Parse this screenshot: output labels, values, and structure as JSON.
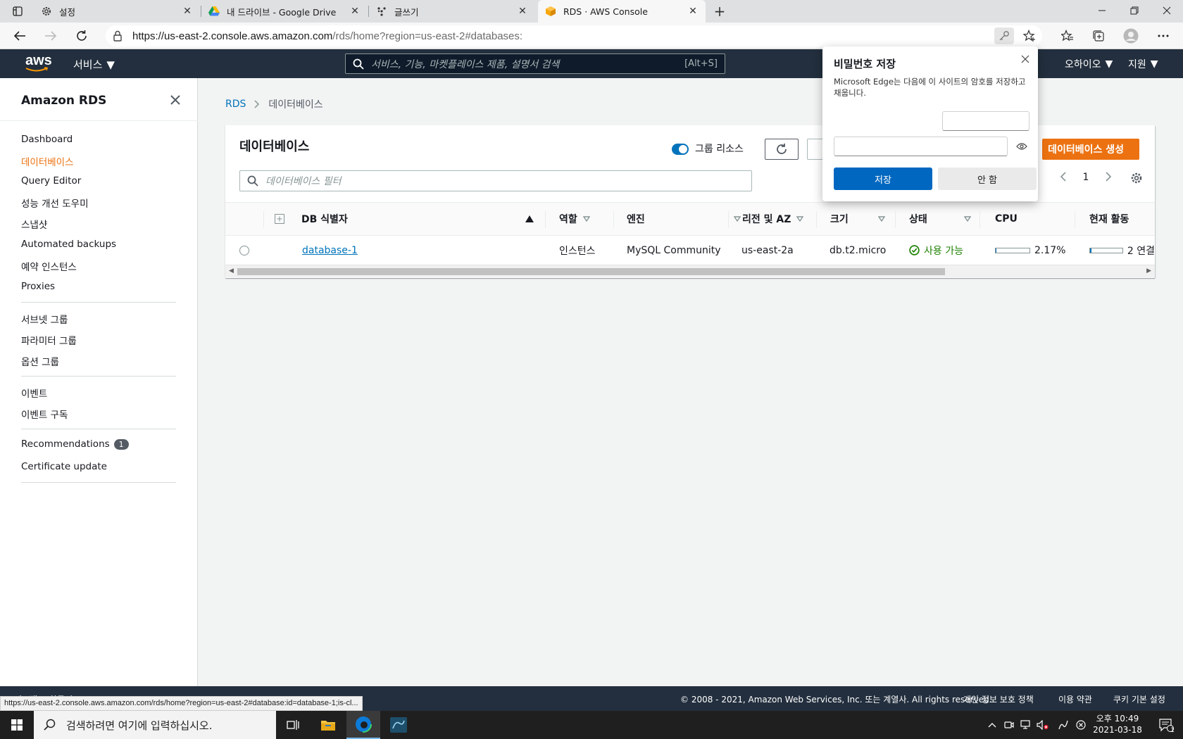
{
  "browser": {
    "tabs": [
      {
        "title": "설정",
        "icon": "gear-icon"
      },
      {
        "title": "내 드라이브 - Google Drive",
        "icon": "google-drive-icon"
      },
      {
        "title": "글쓰기",
        "icon": "app-icon"
      },
      {
        "title": "RDS · AWS Console",
        "icon": "aws-cube-icon",
        "active": true
      }
    ],
    "url_main": "https://us-east-2.console.aws.amazon.com",
    "url_rest": "/rds/home?region=us-east-2#databases:"
  },
  "awsnav": {
    "logo_text": "aws",
    "services_label": "서비스",
    "search_placeholder": "서비스, 기능, 마켓플레이스 제품, 설명서 검색",
    "search_shortcut": "[Alt+S]",
    "region_label": "오하이오",
    "support_label": "지원"
  },
  "sidebar": {
    "title": "Amazon RDS",
    "items": [
      {
        "label": "Dashboard"
      },
      {
        "label": "데이터베이스",
        "active": true
      },
      {
        "label": "Query Editor"
      },
      {
        "label": "성능 개선 도우미"
      },
      {
        "label": "스냅샷"
      },
      {
        "label": "Automated backups"
      },
      {
        "label": "예약 인스턴스"
      },
      {
        "label": "Proxies"
      },
      {
        "label": "서브넷 그룹"
      },
      {
        "label": "파라미터 그룹"
      },
      {
        "label": "옵션 그룹"
      },
      {
        "label": "이벤트"
      },
      {
        "label": "이벤트 구독"
      },
      {
        "label": "Recommendations",
        "badge": "1"
      },
      {
        "label": "Certificate update"
      }
    ]
  },
  "breadcrumb": {
    "root": "RDS",
    "current": "데이터베이스"
  },
  "panel": {
    "title": "데이터베이스",
    "group_resources_label": "그룹 리소스",
    "group_resources_on": true,
    "create_button": "데이터베이스 생성",
    "filter_placeholder": "데이터베이스 필터",
    "page": "1"
  },
  "table": {
    "columns": [
      "DB 식별자",
      "역할",
      "엔진",
      "리전 및 AZ",
      "크기",
      "상태",
      "CPU",
      "현재 활동"
    ],
    "rows": [
      {
        "identifier": "database-1",
        "role": "인스턴스",
        "engine": "MySQL Community",
        "region_az": "us-east-2a",
        "size": "db.t2.micro",
        "status": "사용 가능",
        "cpu": "2.17%",
        "cpu_fraction": 0.0217,
        "activity": "2 연결",
        "activity_fraction": 0.04
      }
    ]
  },
  "password_popup": {
    "title": "비밀번호 저장",
    "description": "Microsoft Edge는 다음에 이 사이트의 암호를 저장하고 채웁니다.",
    "save_label": "저장",
    "never_label": "안 함"
  },
  "footer": {
    "left_text": "피드백",
    "left_text2": "한국어",
    "copyright": "© 2008 - 2021, Amazon Web Services, Inc. 또는 계열사. All rights reserved.",
    "privacy": "개인 정보 보호 정책",
    "terms": "이용 약관",
    "cookies": "쿠키 기본 설정"
  },
  "status_url": "https://us-east-2.console.aws.amazon.com/rds/home?region=us-east-2#database:id=database-1;is-cl...",
  "taskbar": {
    "search_placeholder": "검색하려면 여기에 입력하십시오.",
    "time": "오후 10:49",
    "date": "2021-03-18",
    "notification_count": "1"
  },
  "colors": {
    "aws_nav": "#232f3e",
    "accent_orange": "#ec7211",
    "link_blue": "#0073bb",
    "status_green": "#1d8102",
    "edge_blue": "#0067c0"
  }
}
